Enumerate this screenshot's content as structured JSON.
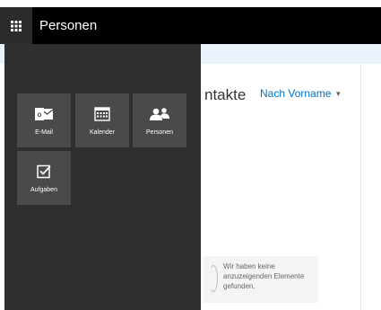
{
  "app": {
    "title": "Personen"
  },
  "background": {
    "heading": "ntakte",
    "sort_label": "Nach Vorname",
    "empty_message": "Wir haben keine anzuzeigenden Elemente gefunden."
  },
  "launcher": {
    "tiles": [
      {
        "label": "E-Mail",
        "icon": "outlook-icon"
      },
      {
        "label": "Kalender",
        "icon": "calendar-icon"
      },
      {
        "label": "Personen",
        "icon": "people-icon"
      },
      {
        "label": "Aufgaben",
        "icon": "tasks-icon"
      }
    ]
  },
  "colors": {
    "topbar": "#000000",
    "panel": "#2f2f2f",
    "tile": "#4a4a4a",
    "accent": "#0072c6"
  }
}
